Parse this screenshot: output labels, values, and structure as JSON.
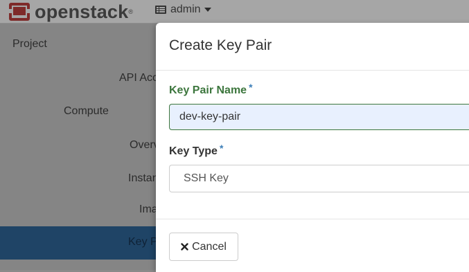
{
  "header": {
    "brand": "openstack",
    "brand_mark": "®",
    "project_label": "admin"
  },
  "sidebar": {
    "items": [
      {
        "label": "Project"
      },
      {
        "label": "API Acc"
      },
      {
        "label": "Compute"
      },
      {
        "label": "Overv"
      },
      {
        "label": "Instan"
      },
      {
        "label": "Ima"
      },
      {
        "label": "Key P"
      }
    ],
    "active_index": 6
  },
  "modal": {
    "title": "Create Key Pair",
    "fields": {
      "name": {
        "label": "Key Pair Name",
        "required": "*",
        "value": "dev-key-pair"
      },
      "type": {
        "label": "Key Type",
        "required": "*",
        "selected": "SSH Key"
      }
    },
    "cancel_label": "Cancel"
  },
  "colors": {
    "success_green": "#3c763d",
    "required_blue": "#3d7fb8",
    "active_nav": "#1f4466",
    "brand_red": "#7e2a29"
  },
  "icons": [
    "openstack-logo-icon",
    "project-grid-icon",
    "caret-down-icon",
    "close-x-icon"
  ]
}
